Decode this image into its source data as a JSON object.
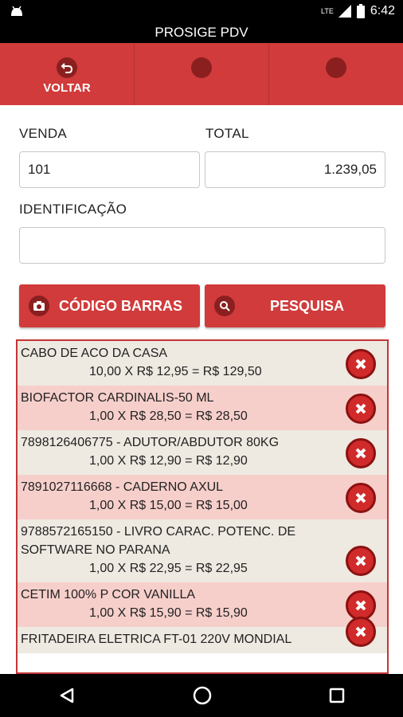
{
  "status_bar": {
    "network": "LTE",
    "time": "6:42"
  },
  "app_title": "PROSIGE PDV",
  "toolbar": {
    "back_label": "VOLTAR"
  },
  "form": {
    "venda_label": "VENDA",
    "venda_value": "101",
    "total_label": "TOTAL",
    "total_value": "1.239,05",
    "ident_label": "IDENTIFICAÇÃO",
    "ident_value": ""
  },
  "buttons": {
    "barcode_label": "CÓDIGO BARRAS",
    "search_label": "PESQUISA"
  },
  "items": [
    {
      "name": "CABO DE ACO DA CASA",
      "line": "10,00 X R$ 12,95 = R$ 129,50"
    },
    {
      "name": "BIOFACTOR CARDINALIS-50 ML",
      "line": "1,00 X R$ 28,50 = R$ 28,50"
    },
    {
      "name": "7898126406775 - ADUTOR/ABDUTOR 80KG",
      "line": "1,00 X R$ 12,90 = R$ 12,90"
    },
    {
      "name": "7891027116668 - CADERNO AXUL",
      "line": "1,00 X R$ 15,00 = R$ 15,00"
    },
    {
      "name": "9788572165150 - LIVRO CARAC. POTENC. DE SOFTWARE NO PARANA",
      "line": "1,00 X R$ 22,95 = R$ 22,95"
    },
    {
      "name": "CETIM 100% P COR VANILLA",
      "line": "1,00 X R$ 15,90 = R$ 15,90"
    },
    {
      "name": "FRITADEIRA ELETRICA FT-01 220V MONDIAL",
      "line": ""
    }
  ],
  "colors": {
    "accent": "#d13b3b",
    "dark_accent": "#8b1f1f",
    "row_even": "#eee9e1",
    "row_odd": "#f6cfcb"
  }
}
